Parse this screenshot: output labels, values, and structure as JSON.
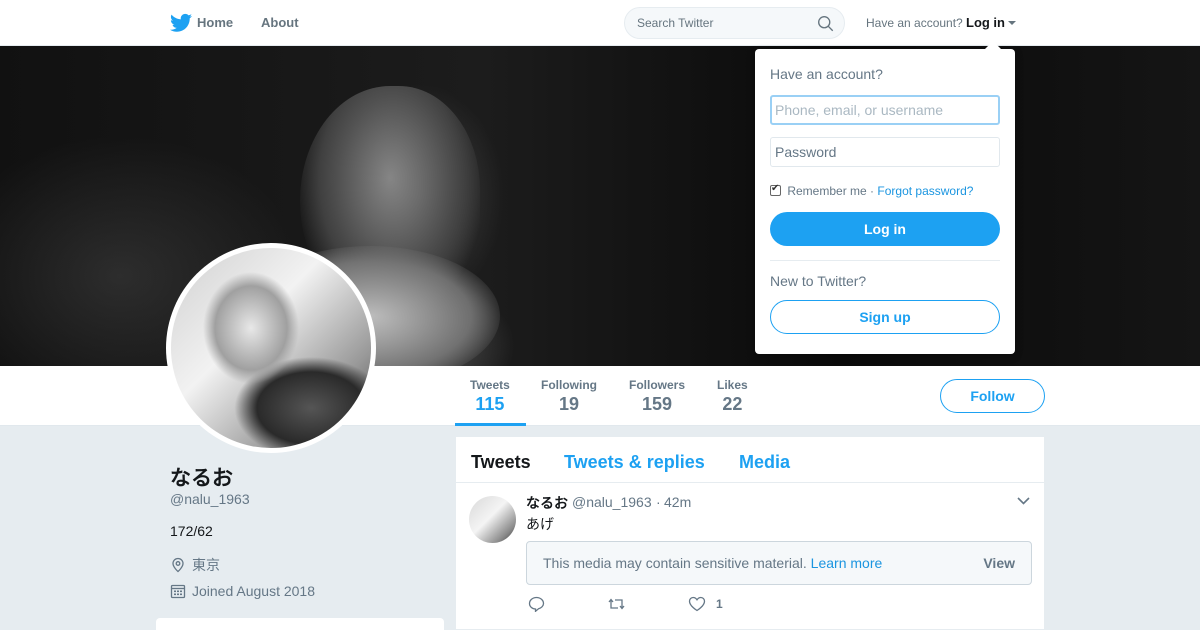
{
  "nav": {
    "logo_icon": "twitter-bird-icon",
    "home_label": "Home",
    "about_label": "About",
    "search_placeholder": "Search Twitter",
    "have_account": "Have an account?",
    "login_label": "Log in"
  },
  "profile": {
    "name": "なるお",
    "handle": "@nalu_1963",
    "bio": "172/62",
    "location": "東京",
    "joined": "Joined August 2018"
  },
  "stats": [
    {
      "label": "Tweets",
      "value": "115"
    },
    {
      "label": "Following",
      "value": "19"
    },
    {
      "label": "Followers",
      "value": "159"
    },
    {
      "label": "Likes",
      "value": "22"
    }
  ],
  "follow_label": "Follow",
  "timeline": {
    "tabs": [
      "Tweets",
      "Tweets & replies",
      "Media"
    ],
    "tweet": {
      "name": "なるお",
      "handle": "@nalu_1963",
      "dot": "·",
      "time": "42m",
      "text": "あげ",
      "sensitive_text": "This media may contain sensitive material.",
      "learn_more": "Learn more",
      "view": "View",
      "likes": "1"
    }
  },
  "login_dropdown": {
    "title": "Have an account?",
    "username_placeholder": "Phone, email, or username",
    "password_placeholder": "Password",
    "remember": "Remember me",
    "separator": "·",
    "forgot": "Forgot password?",
    "login_button": "Log in",
    "new_to": "New to Twitter?",
    "signup_button": "Sign up"
  },
  "colors": {
    "accent": "#1da1f2",
    "background": "#e6ecf0"
  }
}
